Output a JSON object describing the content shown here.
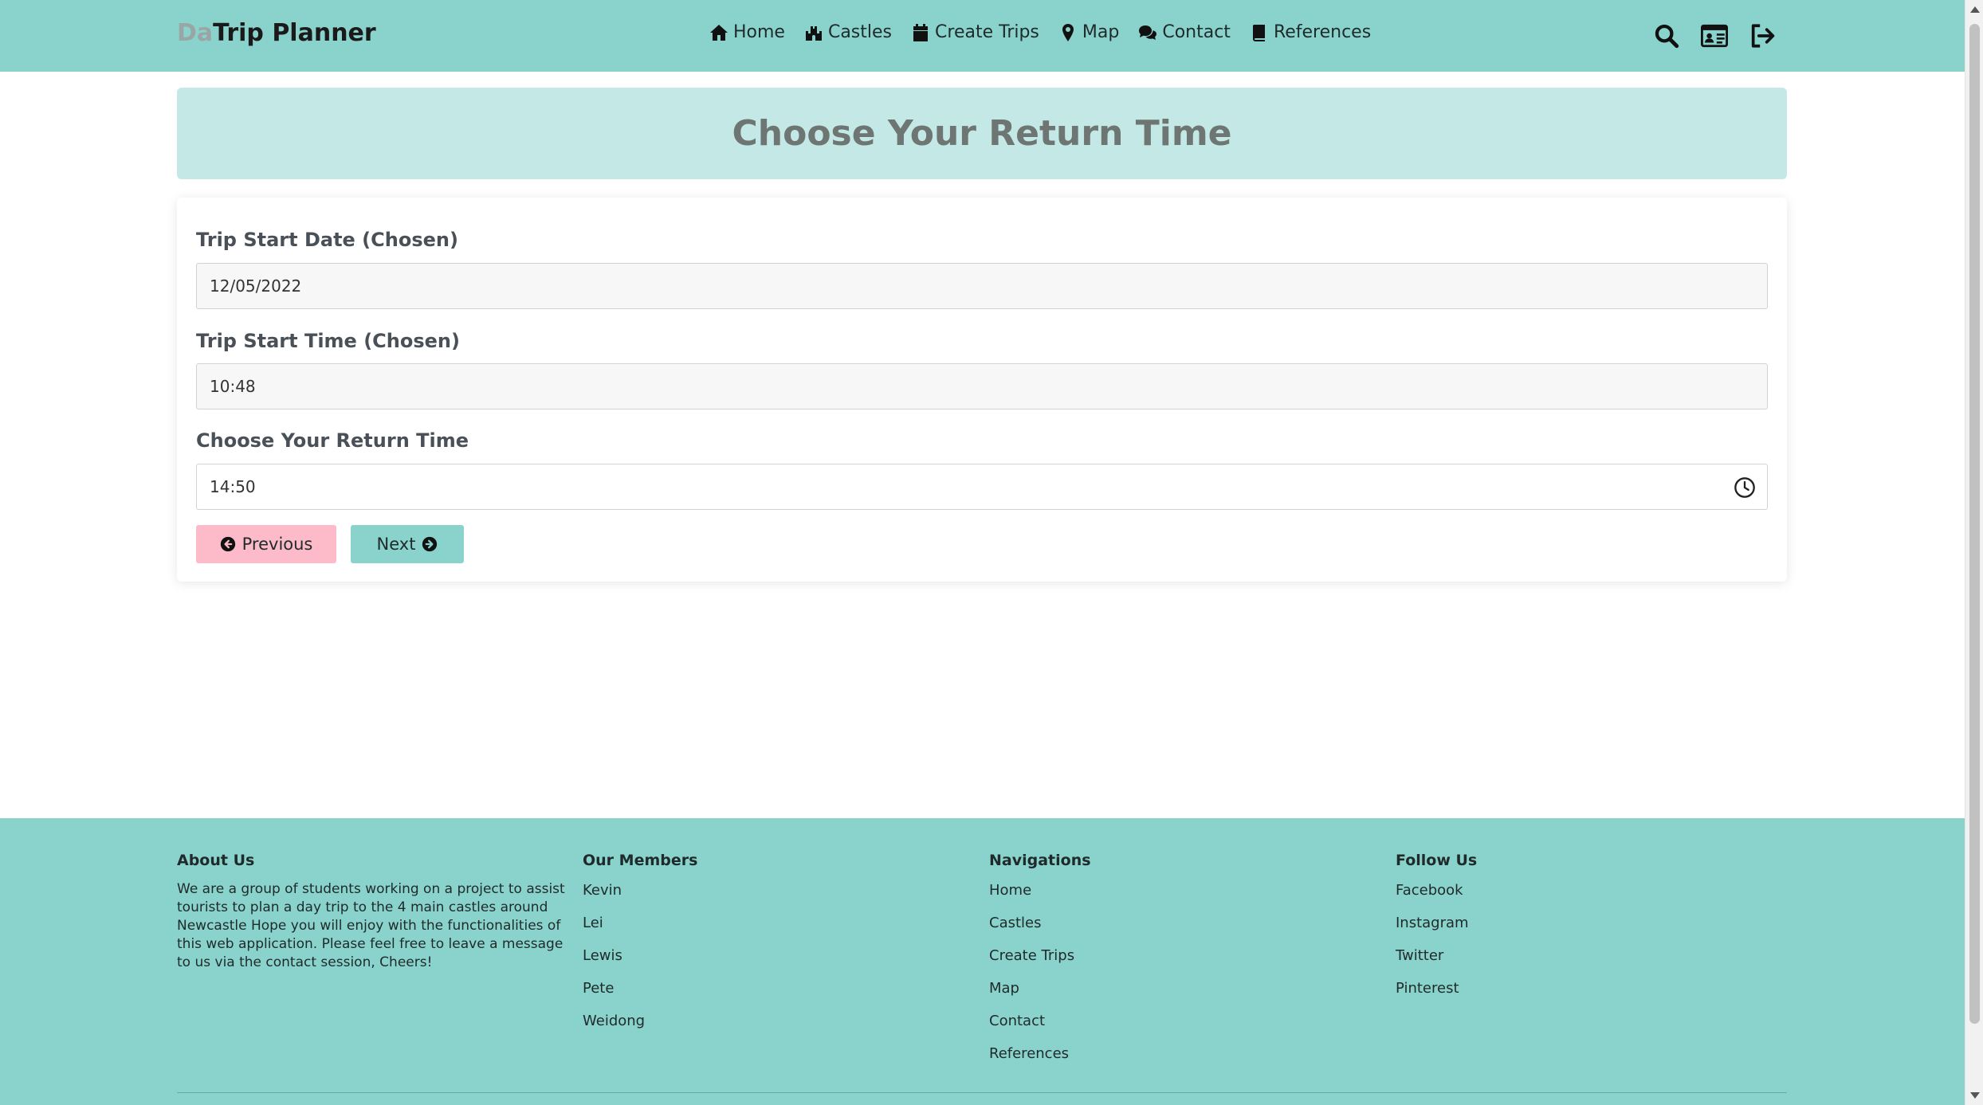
{
  "nav": {
    "brand_prefix": "Da",
    "brand_main": "Trip Planner",
    "links": [
      {
        "label": "Home",
        "icon": "home-icon"
      },
      {
        "label": "Castles",
        "icon": "castle-icon"
      },
      {
        "label": "Create Trips",
        "icon": "calendar-icon"
      },
      {
        "label": "Map",
        "icon": "map-marker-icon"
      },
      {
        "label": "Contact",
        "icon": "comments-icon"
      },
      {
        "label": "References",
        "icon": "book-icon"
      }
    ],
    "right_icons": [
      "search-icon",
      "id-card-icon",
      "sign-out-icon"
    ]
  },
  "page": {
    "title": "Choose Your Return Time"
  },
  "form": {
    "start_date_label": "Trip Start Date (Chosen)",
    "start_date_value": "12/05/2022",
    "start_time_label": "Trip Start Time (Chosen)",
    "start_time_value": "10:48",
    "return_time_label": "Choose Your Return Time",
    "return_time_value": "14:50",
    "previous_label": "Previous",
    "next_label": "Next"
  },
  "footer": {
    "about": {
      "heading": "About Us",
      "text": "We are a group of students working on a project to assist tourists to plan a day trip to the 4 main castles around Newcastle Hope you will enjoy with the functionalities of this web application. Please feel free to leave a message to us via the contact session, Cheers!"
    },
    "members": {
      "heading": "Our Members",
      "items": [
        "Kevin",
        "Lei",
        "Lewis",
        "Pete",
        "Weidong"
      ]
    },
    "navigations": {
      "heading": "Navigations",
      "items": [
        "Home",
        "Castles",
        "Create Trips",
        "Map",
        "Contact",
        "References"
      ]
    },
    "follow": {
      "heading": "Follow Us",
      "items": [
        "Facebook",
        "Instagram",
        "Twitter",
        "Pinterest"
      ]
    }
  },
  "colors": {
    "primary": "#8ad3cc",
    "banner": "#c4e8e5",
    "previous_button": "#fdbac8"
  }
}
